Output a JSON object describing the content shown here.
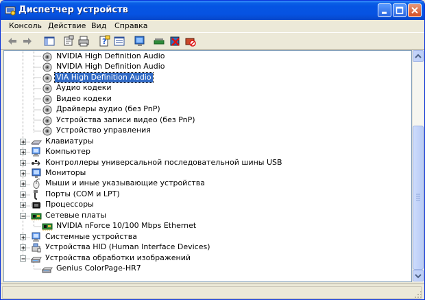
{
  "window": {
    "title": "Диспетчер устройств"
  },
  "menu": [
    {
      "label": "Консоль"
    },
    {
      "label": "Действие"
    },
    {
      "label": "Вид"
    },
    {
      "label": "Справка"
    }
  ],
  "tree": [
    {
      "label": "NVIDIA High Definition Audio",
      "icon": "speaker-icon",
      "indent": 2
    },
    {
      "label": "NVIDIA High Definition Audio",
      "icon": "speaker-icon",
      "indent": 2
    },
    {
      "label": "VIA High Definition Audio",
      "icon": "speaker-icon",
      "indent": 2,
      "selected": true
    },
    {
      "label": "Аудио кодеки",
      "icon": "speaker-icon",
      "indent": 2
    },
    {
      "label": "Видео кодеки",
      "icon": "speaker-icon",
      "indent": 2
    },
    {
      "label": "Драйверы аудио (без PnP)",
      "icon": "speaker-icon",
      "indent": 2
    },
    {
      "label": "Устройства записи видео (без PnP)",
      "icon": "speaker-icon",
      "indent": 2
    },
    {
      "label": "Устройство управления",
      "icon": "speaker-icon",
      "indent": 2
    },
    {
      "label": "Клавиатуры",
      "icon": "keyboard-icon",
      "indent": 1,
      "expander": "plus"
    },
    {
      "label": "Компьютер",
      "icon": "computer-icon",
      "indent": 1,
      "expander": "plus"
    },
    {
      "label": "Контроллеры универсальной последовательной шины USB",
      "icon": "usb-icon",
      "indent": 1,
      "expander": "plus"
    },
    {
      "label": "Мониторы",
      "icon": "monitor-icon",
      "indent": 1,
      "expander": "plus"
    },
    {
      "label": "Мыши и иные указывающие устройства",
      "icon": "mouse-icon",
      "indent": 1,
      "expander": "plus"
    },
    {
      "label": "Порты (COM и LPT)",
      "icon": "port-icon",
      "indent": 1,
      "expander": "plus"
    },
    {
      "label": "Процессоры",
      "icon": "processor-icon",
      "indent": 1,
      "expander": "plus"
    },
    {
      "label": "Сетевые платы",
      "icon": "network-card-icon",
      "indent": 1,
      "expander": "minus"
    },
    {
      "label": "NVIDIA nForce 10/100 Mbps Ethernet",
      "icon": "network-card-icon",
      "indent": 2
    },
    {
      "label": "Системные устройства",
      "icon": "computer-icon",
      "indent": 1,
      "expander": "plus"
    },
    {
      "label": "Устройства HID (Human Interface Devices)",
      "icon": "hid-icon",
      "indent": 1,
      "expander": "plus"
    },
    {
      "label": "Устройства обработки изображений",
      "icon": "scanner-icon",
      "indent": 1,
      "expander": "minus"
    },
    {
      "label": "Genius ColorPage-HR7",
      "icon": "scanner-icon",
      "indent": 2
    }
  ],
  "toolbar": [
    {
      "icon": "back-arrow-icon"
    },
    {
      "icon": "forward-arrow-icon"
    },
    {
      "icon": "show-hide-tree-icon"
    },
    {
      "icon": "properties-icon"
    },
    {
      "icon": "print-icon"
    },
    {
      "icon": "help-icon"
    },
    {
      "icon": "view-icon"
    },
    {
      "icon": "update-driver-icon"
    },
    {
      "icon": "scan-hardware-icon"
    },
    {
      "icon": "uninstall-icon"
    },
    {
      "icon": "disable-icon"
    }
  ],
  "colors": {
    "titlebar": "#0554e3",
    "selection": "#316ac5"
  }
}
